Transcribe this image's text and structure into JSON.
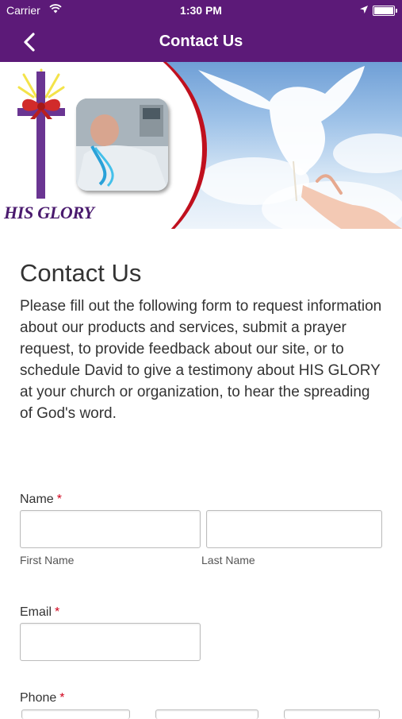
{
  "status_bar": {
    "carrier": "Carrier",
    "time": "1:30 PM"
  },
  "nav": {
    "title": "Contact Us",
    "back_icon": "chevron-left-icon"
  },
  "banner": {
    "logo_text": "HIS GLORY",
    "colors": {
      "purple": "#6a3592",
      "red": "#c0101e"
    }
  },
  "page": {
    "heading": "Contact Us",
    "intro": "Please fill out the following form to request information about our products and services, submit a prayer request, to provide feedback about our site, or to schedule David to give a testimony about HIS GLORY at your church or organization, to hear the spreading of God's word."
  },
  "form": {
    "required_marker": "*",
    "name": {
      "label": "Name",
      "first_value": "",
      "last_value": "",
      "first_sublabel": "First Name",
      "last_sublabel": "Last Name"
    },
    "email": {
      "label": "Email",
      "value": ""
    },
    "phone": {
      "label": "Phone"
    }
  },
  "theme": {
    "header_bg": "#5c1a78",
    "required_color": "#d0021b"
  }
}
